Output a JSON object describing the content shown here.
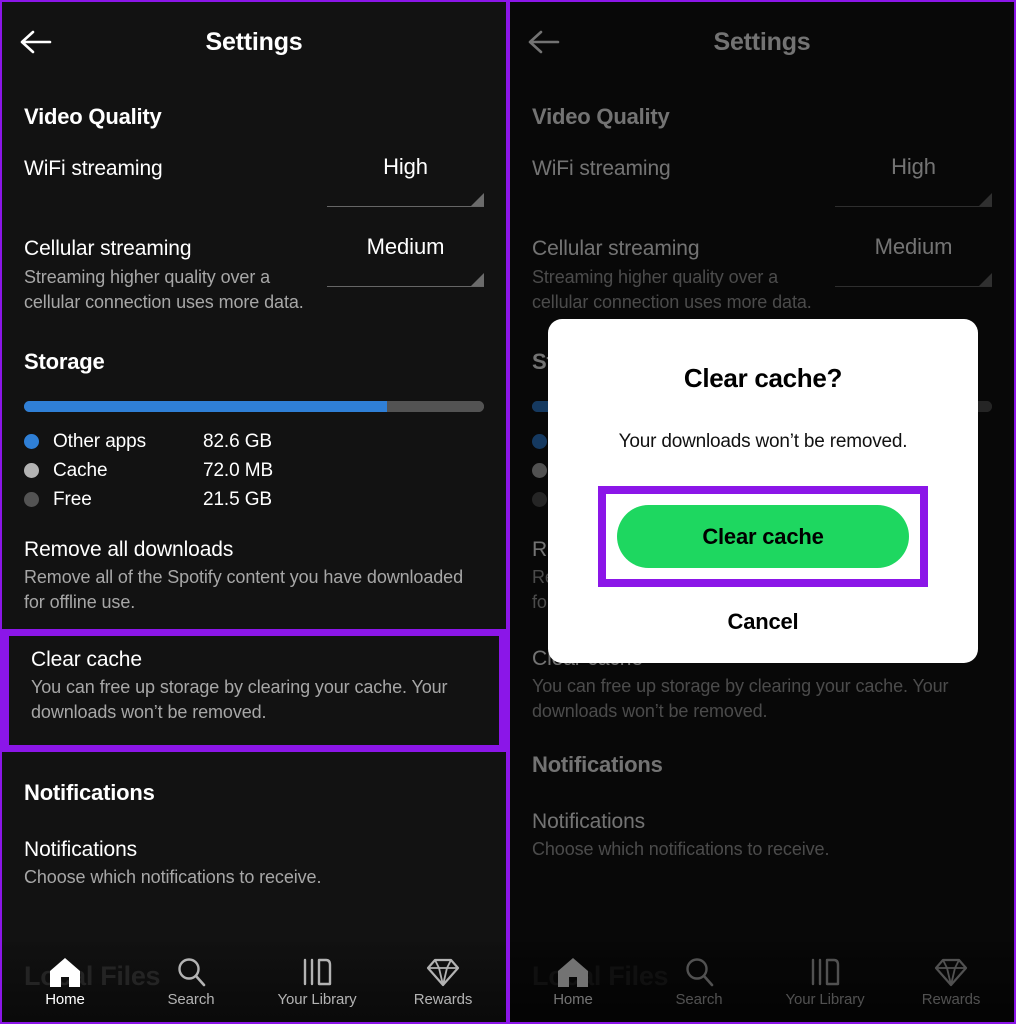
{
  "theme": {
    "bg": "#121212",
    "highlight_purple": "#8B16E8",
    "accent_green": "#1ED760",
    "bar_blue": "#2F7FD6",
    "bar_light_gray": "#B3B3B3",
    "bar_dark_gray": "#535353"
  },
  "header": {
    "title": "Settings",
    "back_icon": "arrow-left-icon"
  },
  "sections": {
    "video_quality": {
      "heading": "Video Quality",
      "rows": [
        {
          "title": "WiFi streaming",
          "subtitle": "",
          "value": "High"
        },
        {
          "title": "Cellular streaming",
          "subtitle": "Streaming higher quality over a cellular connection uses more data.",
          "value": "Medium"
        }
      ]
    },
    "storage": {
      "heading": "Storage",
      "bar": [
        {
          "label": "Other apps",
          "color": "#2F7FD6",
          "percent": 79
        },
        {
          "label": "Free",
          "color": "#535353",
          "percent": 21
        }
      ],
      "legend": [
        {
          "label": "Other apps",
          "value": "82.6 GB",
          "color": "#2F7FD6"
        },
        {
          "label": "Cache",
          "value": "72.0 MB",
          "color": "#B3B3B3"
        },
        {
          "label": "Free",
          "value": "21.5 GB",
          "color": "#535353"
        }
      ],
      "actions": [
        {
          "title": "Remove all downloads",
          "subtitle": "Remove all of the Spotify content you have downloaded for offline use.",
          "highlighted": false
        },
        {
          "title": "Clear cache",
          "subtitle": "You can free up storage by clearing your cache. Your downloads won’t be removed.",
          "highlighted": true
        }
      ]
    },
    "notifications": {
      "heading": "Notifications",
      "rows": [
        {
          "title": "Notifications",
          "subtitle": "Choose which notifications to receive."
        }
      ]
    }
  },
  "bottom_nav": {
    "ghost_label": "Local Files",
    "items": [
      {
        "label": "Home",
        "icon": "home-icon",
        "active": true
      },
      {
        "label": "Search",
        "icon": "search-icon",
        "active": false
      },
      {
        "label": "Your Library",
        "icon": "library-icon",
        "active": false
      },
      {
        "label": "Rewards",
        "icon": "diamond-icon",
        "active": false
      }
    ]
  },
  "dialog": {
    "title": "Clear cache?",
    "message": "Your downloads won’t be removed.",
    "primary_label": "Clear cache",
    "cancel_label": "Cancel"
  }
}
